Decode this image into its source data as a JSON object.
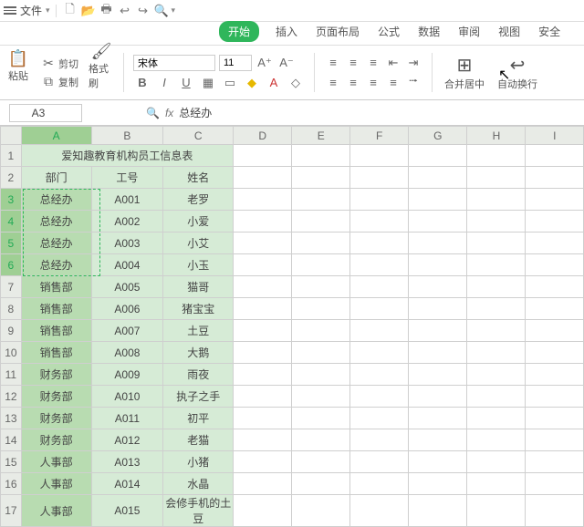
{
  "menu": {
    "file": "文件",
    "qat": [
      "🗋",
      "📂",
      "🖶",
      "↩",
      "↪",
      "🔍"
    ]
  },
  "tabs": [
    "开始",
    "插入",
    "页面布局",
    "公式",
    "数据",
    "审阅",
    "视图",
    "安全"
  ],
  "active_tab": 0,
  "ribbon": {
    "paste": "粘贴",
    "cut": "剪切",
    "copy": "复制",
    "fmtpaint": "格式刷",
    "font_name": "宋体",
    "font_size": "11",
    "merge": "合并居中",
    "wrap": "自动换行"
  },
  "cellref": {
    "name": "A3",
    "fx": "fx",
    "value": "总经办"
  },
  "cols": [
    "A",
    "B",
    "C",
    "D",
    "E",
    "F",
    "G",
    "H",
    "I"
  ],
  "sheet": {
    "title": "爱知趣教育机构员工信息表",
    "headers": [
      "部门",
      "工号",
      "姓名"
    ],
    "rows": [
      [
        "总经办",
        "A001",
        "老罗"
      ],
      [
        "总经办",
        "A002",
        "小爱"
      ],
      [
        "总经办",
        "A003",
        "小艾"
      ],
      [
        "总经办",
        "A004",
        "小玉"
      ],
      [
        "销售部",
        "A005",
        "猫哥"
      ],
      [
        "销售部",
        "A006",
        "猪宝宝"
      ],
      [
        "销售部",
        "A007",
        "土豆"
      ],
      [
        "销售部",
        "A008",
        "大鹅"
      ],
      [
        "财务部",
        "A009",
        "雨夜"
      ],
      [
        "财务部",
        "A010",
        "执子之手"
      ],
      [
        "财务部",
        "A011",
        "初平"
      ],
      [
        "财务部",
        "A012",
        "老猫"
      ],
      [
        "人事部",
        "A013",
        "小猪"
      ],
      [
        "人事部",
        "A014",
        "水晶"
      ],
      [
        "人事部",
        "A015",
        "会修手机的土豆"
      ]
    ]
  },
  "chart_data": {
    "type": "table",
    "title": "爱知趣教育机构员工信息表",
    "columns": [
      "部门",
      "工号",
      "姓名"
    ],
    "rows": [
      [
        "总经办",
        "A001",
        "老罗"
      ],
      [
        "总经办",
        "A002",
        "小爱"
      ],
      [
        "总经办",
        "A003",
        "小艾"
      ],
      [
        "总经办",
        "A004",
        "小玉"
      ],
      [
        "销售部",
        "A005",
        "猫哥"
      ],
      [
        "销售部",
        "A006",
        "猪宝宝"
      ],
      [
        "销售部",
        "A007",
        "土豆"
      ],
      [
        "销售部",
        "A008",
        "大鹅"
      ],
      [
        "财务部",
        "A009",
        "雨夜"
      ],
      [
        "财务部",
        "A010",
        "执子之手"
      ],
      [
        "财务部",
        "A011",
        "初平"
      ],
      [
        "财务部",
        "A012",
        "老猫"
      ],
      [
        "人事部",
        "A013",
        "小猪"
      ],
      [
        "人事部",
        "A014",
        "水晶"
      ],
      [
        "人事部",
        "A015",
        "会修手机的土豆"
      ]
    ]
  }
}
